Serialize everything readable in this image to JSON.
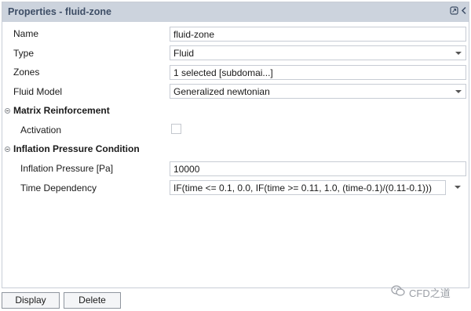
{
  "panel": {
    "title": "Properties - fluid-zone",
    "pin_icon": "pin-icon",
    "collapse_icon": "chevron-left-icon"
  },
  "fields": {
    "name": {
      "label": "Name",
      "value": "fluid-zone"
    },
    "type": {
      "label": "Type",
      "value": "Fluid"
    },
    "zones": {
      "label": "Zones",
      "value": "1 selected [subdomai...]"
    },
    "fluid_model": {
      "label": "Fluid Model",
      "value": "Generalized newtonian"
    }
  },
  "matrix_reinforcement": {
    "heading": "Matrix Reinforcement",
    "activation_label": "Activation",
    "activation_checked": false
  },
  "inflation_pressure": {
    "heading": "Inflation Pressure Condition",
    "pressure_label": "Inflation Pressure [Pa]",
    "pressure_value": "10000",
    "time_dependency_label": "Time Dependency",
    "time_dependency_value": "IF(time <= 0.1, 0.0, IF(time >= 0.11, 1.0, (time-0.1)/(0.11-0.1)))"
  },
  "buttons": {
    "display": "Display",
    "delete": "Delete"
  },
  "watermark": {
    "text": "CFD之道"
  }
}
